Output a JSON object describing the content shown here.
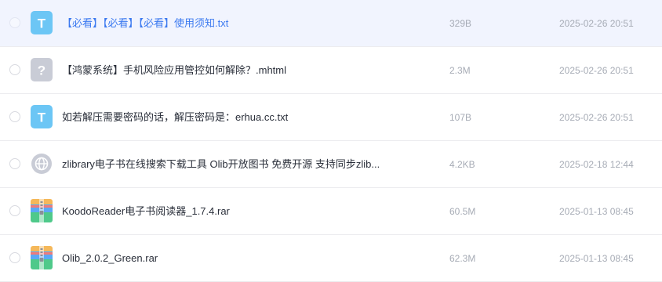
{
  "files": [
    {
      "name": "【必看】【必看】【必看】使用须知.txt",
      "size": "329B",
      "date": "2025-02-26 20:51",
      "icon": "txt-file-icon",
      "highlighted": true
    },
    {
      "name": "【鸿蒙系统】手机风险应用管控如何解除？.mhtml",
      "size": "2.3M",
      "date": "2025-02-26 20:51",
      "icon": "unknown-file-icon"
    },
    {
      "name": "如若解压需要密码的话，解压密码是：erhua.cc.txt",
      "size": "107B",
      "date": "2025-02-26 20:51",
      "icon": "txt-file-icon"
    },
    {
      "name": "zlibrary电子书在线搜索下载工具 Olib开放图书 免费开源 支持同步zlib...",
      "size": "4.2KB",
      "date": "2025-02-18 12:44",
      "icon": "web-link-icon"
    },
    {
      "name": "KoodoReader电子书阅读器_1.7.4.rar",
      "size": "60.5M",
      "date": "2025-01-13 08:45",
      "icon": "archive-file-icon"
    },
    {
      "name": "Olib_2.0.2_Green.rar",
      "size": "62.3M",
      "date": "2025-01-13 08:45",
      "icon": "archive-file-icon"
    }
  ],
  "colors": {
    "txt_icon": "#6cc6f5",
    "unknown_icon": "#c9ccd6",
    "web_icon": "#c9ccd6",
    "highlight_row_bg": "#f1f4fe",
    "highlight_text": "#3b79f0"
  }
}
